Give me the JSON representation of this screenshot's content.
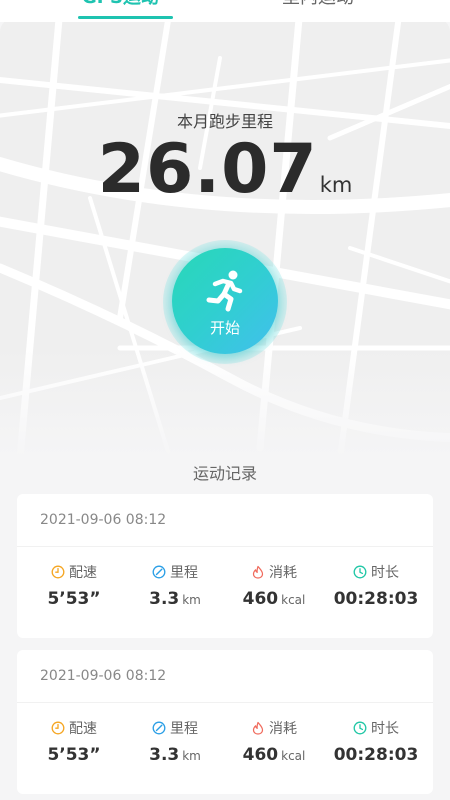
{
  "tabs": [
    {
      "label": "GPS运动",
      "active": true
    },
    {
      "label": "室内运动",
      "active": false
    }
  ],
  "hero": {
    "month_label": "本月跑步里程",
    "distance_value": "26.07",
    "distance_unit": "km",
    "start_label": "开始",
    "start_icon": "running-person-icon"
  },
  "records": {
    "title": "运动记录",
    "items": [
      {
        "datetime": "2021-09-06  08:12",
        "pace": {
          "label": "配速",
          "value": "5’53”",
          "icon": "pace-icon"
        },
        "distance": {
          "label": "里程",
          "value": "3.3",
          "unit": "km",
          "icon": "distance-icon"
        },
        "calories": {
          "label": "消耗",
          "value": "460",
          "unit": "kcal",
          "icon": "flame-icon"
        },
        "duration": {
          "label": "时长",
          "value": "00:28:03",
          "icon": "clock-icon"
        }
      },
      {
        "datetime": "2021-09-06  08:12",
        "pace": {
          "label": "配速",
          "value": "5’53”",
          "icon": "pace-icon"
        },
        "distance": {
          "label": "里程",
          "value": "3.3",
          "unit": "km",
          "icon": "distance-icon"
        },
        "calories": {
          "label": "消耗",
          "value": "460",
          "unit": "kcal",
          "icon": "flame-icon"
        },
        "duration": {
          "label": "时长",
          "value": "00:28:03",
          "icon": "clock-icon"
        }
      }
    ]
  },
  "colors": {
    "accent": "#1ec3b0",
    "pace_icon": "#f5a623",
    "distance_icon": "#2b9fe6",
    "calories_icon": "#f06a5c",
    "duration_icon": "#21c7a6"
  }
}
